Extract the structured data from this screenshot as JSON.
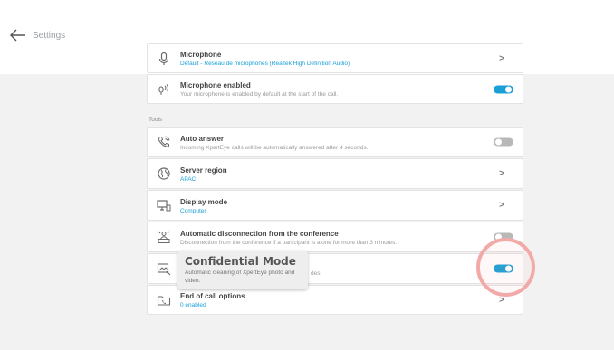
{
  "header": {
    "title": "Settings"
  },
  "items": [
    {
      "title": "Microphone",
      "subtitle": "Default - Réseau de microphones (Realtek High Definition Audio)",
      "control": "chevron"
    },
    {
      "title": "Microphone enabled",
      "subtitle": "Your microphone is enabled by default at the start of the call.",
      "control": "toggle",
      "toggle_state": "on"
    },
    {
      "title": "Auto answer",
      "subtitle": "Incoming XpertEye calls will be automatically answered after 4 seconds.",
      "control": "toggle",
      "toggle_state": "off"
    },
    {
      "title": "Server region",
      "subtitle": "APAC",
      "control": "chevron"
    },
    {
      "title": "Display mode",
      "subtitle": "Computer",
      "control": "chevron"
    },
    {
      "title": "Automatic disconnection from the conference",
      "subtitle": "Disconnection from the conference if a participant is alone for more than 3 minutes.",
      "control": "toggle",
      "toggle_state": "off"
    },
    {
      "title": "",
      "subtitle": "des.",
      "control": "toggle",
      "toggle_state": "on"
    },
    {
      "title": "End of call options",
      "subtitle": "0 enabled",
      "control": "chevron"
    }
  ],
  "section": {
    "tools_label": "Tools"
  },
  "chevron_glyph": ">",
  "tooltip": {
    "title": "Confidential Mode",
    "description": "Automatic cleaning of XpertEye photo and video."
  },
  "colors": {
    "accent": "#1aa0d6",
    "toggle_off": "#b8b8b8",
    "highlight_ring": "#f2aaa8"
  }
}
